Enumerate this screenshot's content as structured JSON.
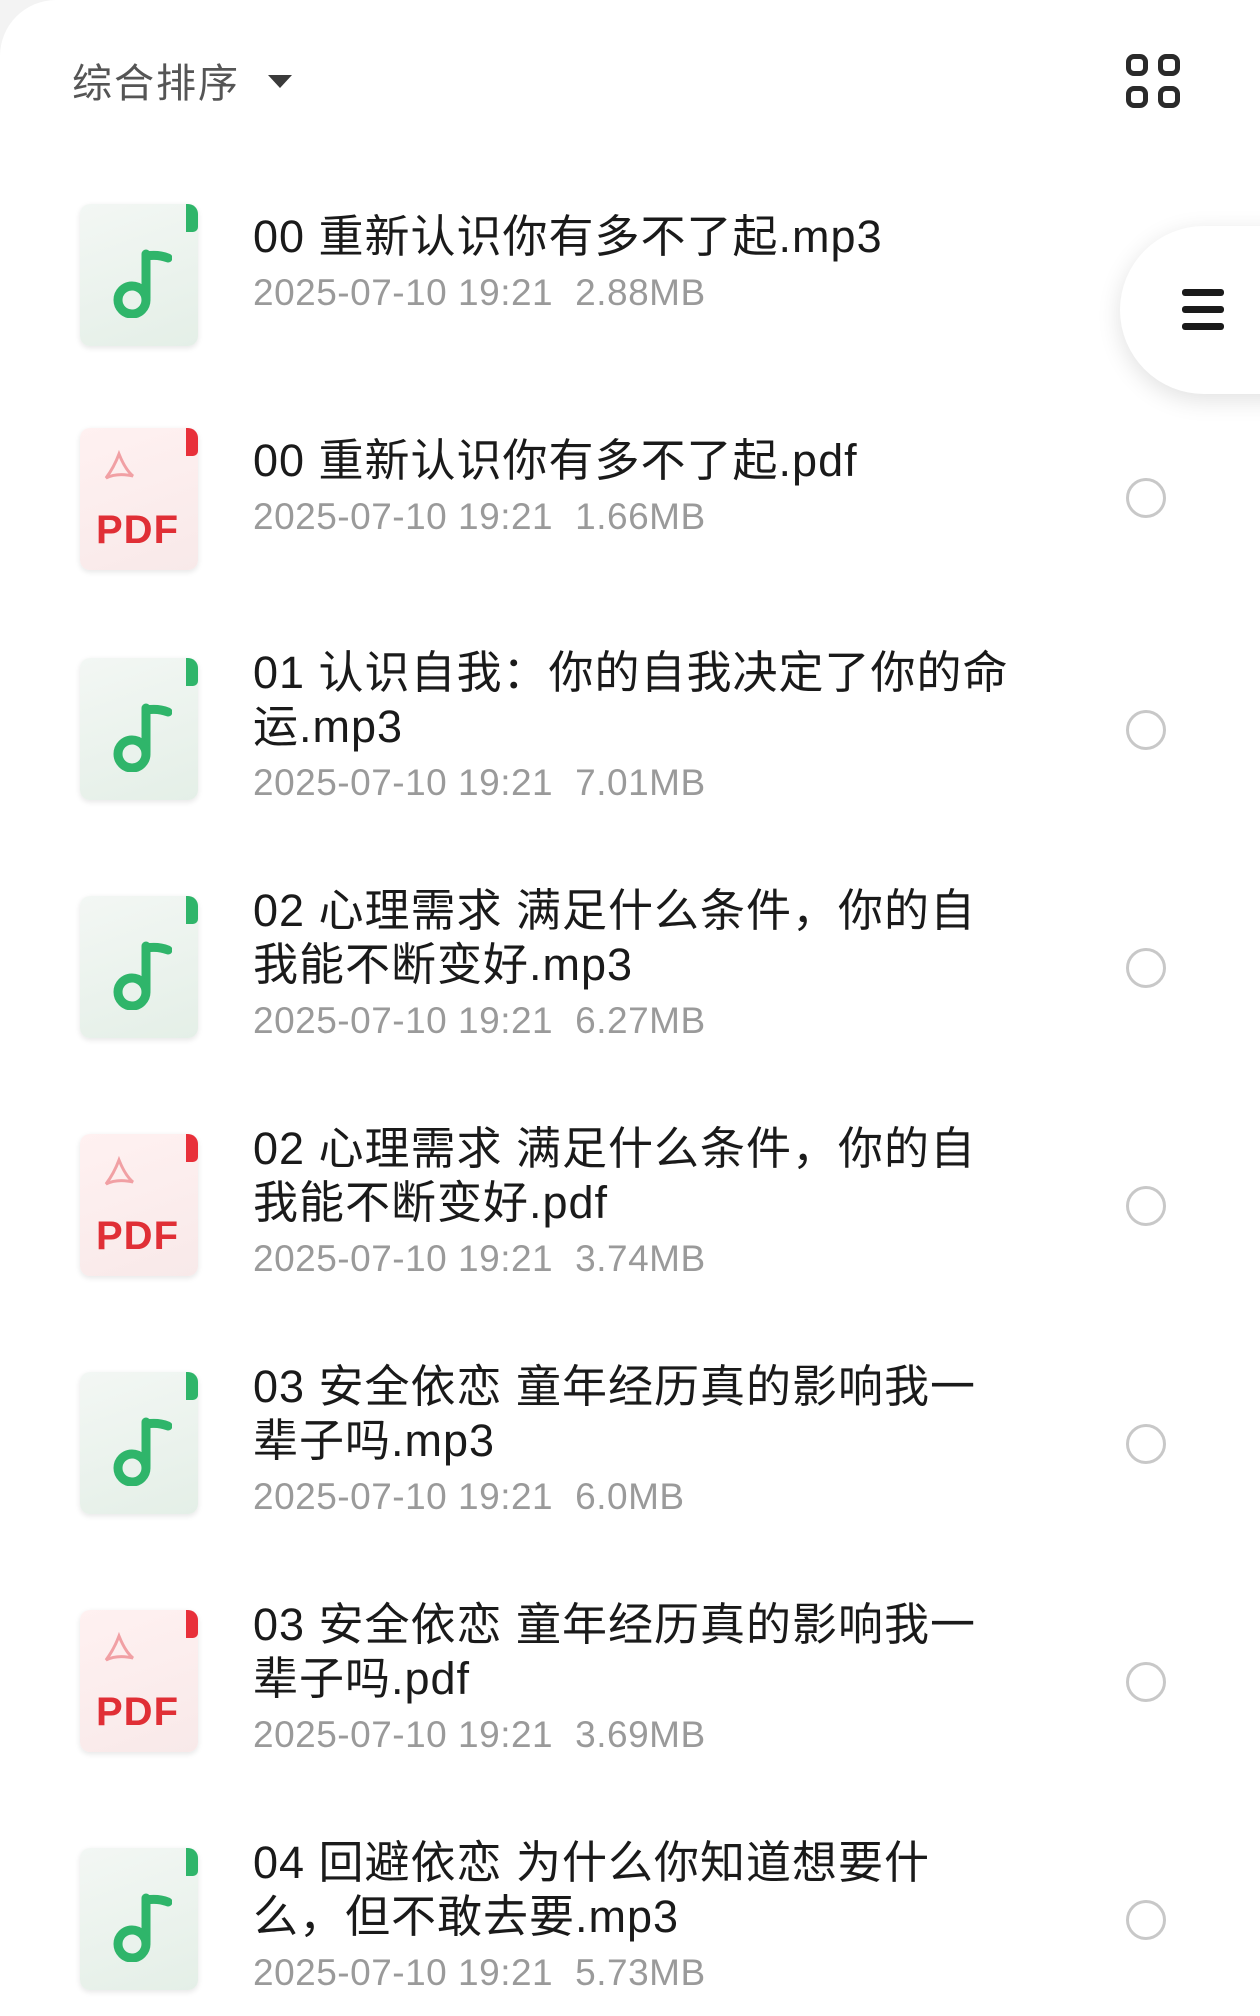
{
  "toolbar": {
    "sort_label": "综合排序",
    "sort_caret_icon": "caret-down-icon",
    "view_toggle_icon": "grid-view-icon"
  },
  "floating_button": {
    "icon": "menu-icon"
  },
  "colors": {
    "audio_accent": "#2fb56a",
    "pdf_accent": "#e8303a",
    "meta_text": "#9a9a9a"
  },
  "files": [
    {
      "type": "audio",
      "name": "00 重新认识你有多不了起.mp3",
      "date": "2025-07-10 19:21",
      "size": "2.88MB"
    },
    {
      "type": "pdf",
      "name": "00 重新认识你有多不了起.pdf",
      "date": "2025-07-10 19:21",
      "size": "1.66MB",
      "badge": "PDF"
    },
    {
      "type": "audio",
      "name": "01 认识自我：你的自我决定了你的命运.mp3",
      "date": "2025-07-10 19:21",
      "size": "7.01MB"
    },
    {
      "type": "audio",
      "name": "02 心理需求 满足什么条件，你的自我能不断变好.mp3",
      "date": "2025-07-10 19:21",
      "size": "6.27MB"
    },
    {
      "type": "pdf",
      "name": "02 心理需求 满足什么条件，你的自我能不断变好.pdf",
      "date": "2025-07-10 19:21",
      "size": "3.74MB",
      "badge": "PDF"
    },
    {
      "type": "audio",
      "name": "03 安全依恋 童年经历真的影响我一辈子吗.mp3",
      "date": "2025-07-10 19:21",
      "size": "6.0MB"
    },
    {
      "type": "pdf",
      "name": "03 安全依恋 童年经历真的影响我一辈子吗.pdf",
      "date": "2025-07-10 19:21",
      "size": "3.69MB",
      "badge": "PDF"
    },
    {
      "type": "audio",
      "name": "04 回避依恋 为什么你知道想要什么，但不敢去要.mp3",
      "date": "2025-07-10 19:21",
      "size": "5.73MB"
    }
  ]
}
